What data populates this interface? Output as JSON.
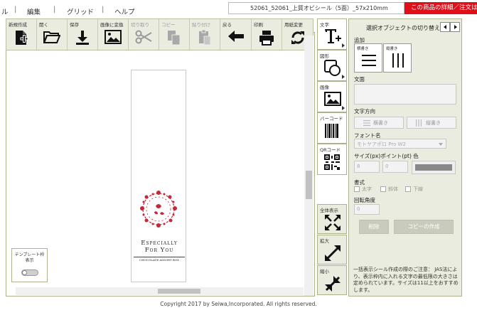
{
  "menu": {
    "item1": "ル",
    "item2": "編集",
    "item3": "グリッド",
    "item4": "ヘルプ",
    "separator": "|"
  },
  "document": {
    "name": "52061_52061_上質オビシール（5面）_57x210mm"
  },
  "detail_button": "この商品の詳細／注文は",
  "toolbar": {
    "new": "新規作成",
    "open": "開く",
    "save": "保存",
    "to_image": "画像に変換",
    "cut": "切り取り",
    "copy": "コピー",
    "paste": "貼り付け",
    "back": "戻る",
    "print": "印刷",
    "change_paper": "用紙変更"
  },
  "label_design": {
    "title_line1": "Especially",
    "title_line2": "For You",
    "subtitle": "CHOCOLATE ASSORT BOX"
  },
  "template_frame": {
    "label_line1": "テンプレート枠",
    "label_line2": "表示"
  },
  "insert": {
    "text": "文字",
    "shape": "図形",
    "image": "画像",
    "barcode": "バーコード",
    "qrcode": "QRコード"
  },
  "zoom": {
    "fit": "全体表示",
    "zoom_in": "拡大",
    "zoom_out": "縮小"
  },
  "props": {
    "title": "選択オブジェクトの切り替え",
    "add_label": "追加",
    "horizontal": "横書き",
    "vertical": "縦書き",
    "text_label": "文面",
    "direction_label": "文字方向",
    "font_label": "フォント名",
    "font_value": "モトヤアポロ Pro W2",
    "size_label": "サイズ(px)ポイント(pt) 色",
    "size_px": "8",
    "size_pt": "0",
    "style_label": "書式",
    "bold": "太字",
    "italic": "斜体",
    "underline": "下線",
    "rotation_label": "回転角度",
    "rotation_value": "0",
    "delete": "削除",
    "duplicate": "コピーの作成",
    "notice": "一括表示シール作成の際のご注意： JAS法により、表示枠内に入れる文字の最低限の大きさは定められています。サイズは11以上をおすすめします。"
  },
  "footer": "Copyright 2017 by Seiwa,Incorporated. All rights reserved.",
  "colors": {
    "accent_red": "#e0101a",
    "toolbar_bg": "#e9ecde",
    "border_green": "#a9b48a",
    "wreath_red": "#c4283a"
  }
}
